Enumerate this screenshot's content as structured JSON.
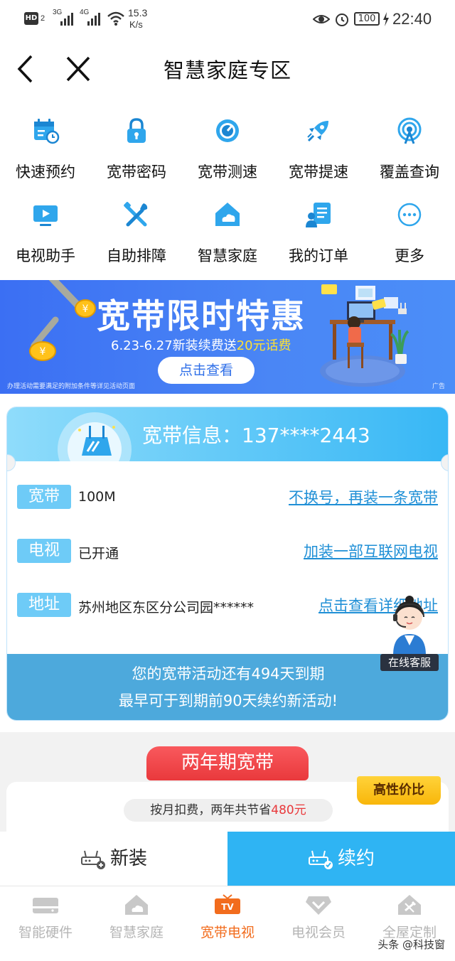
{
  "status_bar": {
    "hd": "HD",
    "hd_sub": "2",
    "net1": "3G",
    "net2": "4G",
    "speed_value": "15.3",
    "speed_unit": "K/s",
    "battery": "100",
    "time": "22:40"
  },
  "header": {
    "title": "智慧家庭专区"
  },
  "quick_grid": [
    {
      "label": "快速预约",
      "icon": "calendar-clock-icon"
    },
    {
      "label": "宽带密码",
      "icon": "lock-icon"
    },
    {
      "label": "宽带测速",
      "icon": "speedometer-icon"
    },
    {
      "label": "宽带提速",
      "icon": "rocket-icon"
    },
    {
      "label": "覆盖查询",
      "icon": "signal-coverage-icon"
    },
    {
      "label": "电视助手",
      "icon": "tv-play-icon"
    },
    {
      "label": "自助排障",
      "icon": "tools-icon"
    },
    {
      "label": "智慧家庭",
      "icon": "smart-home-icon"
    },
    {
      "label": "我的订单",
      "icon": "order-list-icon"
    },
    {
      "label": "更多",
      "icon": "more-dots-icon"
    }
  ],
  "banner": {
    "headline": "宽带限时特惠",
    "sub_prefix": "6.23-6.27新装续费送",
    "sub_highlight": "20元话费",
    "cta": "点击查看",
    "disclaimer": "办理活动需要满足的附加条件等详见活动页面",
    "ad_label": "广告"
  },
  "info_card": {
    "title": "宽带信息：137****2443",
    "rows": [
      {
        "tag": "宽带",
        "value": "100M",
        "link": "不换号，再装一条宽带"
      },
      {
        "tag": "电视",
        "value": "已开通",
        "link": "加装一部互联网电视"
      },
      {
        "tag": "地址",
        "value": "苏州地区东区分公司园******",
        "link": "点击查看详细地址"
      }
    ],
    "footer_line1": "您的宽带活动还有494天到期",
    "footer_line2": "最早可于到期前90天续约新活动!",
    "agent_label": "在线客服"
  },
  "plan": {
    "ribbon": "两年期宽带",
    "badge": "高性价比",
    "note_prefix": "按月扣费，两年共节省",
    "note_highlight": "480元"
  },
  "actions": {
    "new_label": "新装",
    "renew_label": "续约"
  },
  "tabbar": [
    {
      "label": "智能硬件",
      "icon": "hardware-icon",
      "active": false
    },
    {
      "label": "智慧家庭",
      "icon": "home-cloud-icon",
      "active": false
    },
    {
      "label": "宽带电视",
      "icon": "tv-icon",
      "active": true,
      "icon_text": "TV"
    },
    {
      "label": "电视会员",
      "icon": "diamond-icon",
      "active": false
    },
    {
      "label": "全屋定制",
      "icon": "house-custom-icon",
      "active": false
    }
  ],
  "watermark": "头条 @科技窗",
  "colors": {
    "accent_blue": "#2fb4f3",
    "link_blue": "#1f8fd6",
    "tab_active": "#f26c1d",
    "highlight_red": "#e9393c",
    "banner_yellow": "#ffe033"
  }
}
